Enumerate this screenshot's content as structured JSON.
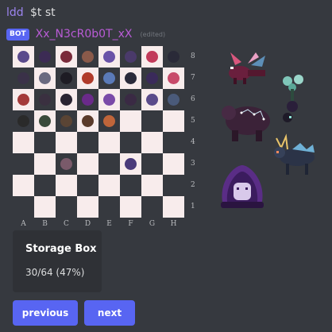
{
  "previous_message": {
    "user": "ldd",
    "text": "$t st"
  },
  "message": {
    "bot_tag": "BOT",
    "author": "Xx_N3cR0b0T_xX",
    "edited": "(edited)"
  },
  "board": {
    "files": [
      "A",
      "B",
      "C",
      "D",
      "E",
      "F",
      "G",
      "H"
    ],
    "ranks": [
      "8",
      "7",
      "6",
      "5",
      "4",
      "3",
      "2",
      "1"
    ]
  },
  "storage_box": {
    "title": "Storage Box",
    "value": "30/64 (47%)"
  },
  "buttons": {
    "previous": "previous",
    "next": "next"
  },
  "colors": {
    "background": "#36393f",
    "accent": "#5865f2",
    "board_light": "#f8ecec",
    "author": "#b95bd6"
  }
}
